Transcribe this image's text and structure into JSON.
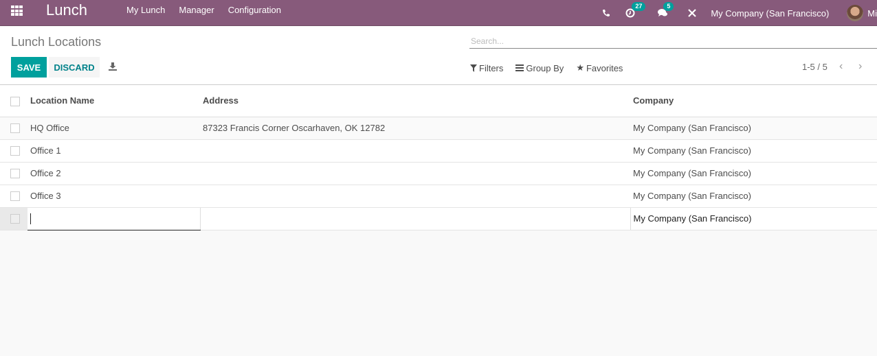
{
  "navbar": {
    "app_name": "Lunch",
    "menu": [
      "My Lunch",
      "Manager",
      "Configuration"
    ],
    "activity_count": "27",
    "messages_count": "5",
    "company": "My Company (San Francisco)",
    "user_initials": "Mi",
    "icons": {
      "apps": "apps-grid-icon",
      "phone": "phone-icon",
      "activity": "clock-icon",
      "messages": "chat-icon",
      "debug": "tools-icon"
    }
  },
  "control_panel": {
    "breadcrumb": "Lunch Locations",
    "search_placeholder": "Search...",
    "save_label": "SAVE",
    "discard_label": "DISCARD",
    "filters_label": "Filters",
    "groupby_label": "Group By",
    "favorites_label": "Favorites",
    "pager": "1-5 / 5"
  },
  "table": {
    "columns": [
      "Location Name",
      "Address",
      "Company"
    ],
    "rows": [
      {
        "name": "HQ Office",
        "address": "87323 Francis Corner Oscarhaven, OK 12782",
        "company": "My Company (San Francisco)"
      },
      {
        "name": "Office 1",
        "address": "",
        "company": "My Company (San Francisco)"
      },
      {
        "name": "Office 2",
        "address": "",
        "company": "My Company (San Francisco)"
      },
      {
        "name": "Office 3",
        "address": "",
        "company": "My Company (San Francisco)"
      }
    ],
    "new_row": {
      "name": "",
      "address": "",
      "company": "My Company (San Francisco)"
    }
  }
}
